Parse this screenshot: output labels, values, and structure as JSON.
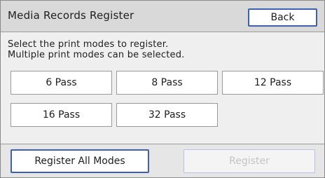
{
  "header": {
    "title": "Media Records Register",
    "back_label": "Back"
  },
  "instructions": {
    "line1": "Select the print modes to register.",
    "line2": "Multiple print modes can be selected."
  },
  "modes": [
    {
      "label": "6 Pass"
    },
    {
      "label": "8 Pass"
    },
    {
      "label": "12 Pass"
    },
    {
      "label": "16 Pass"
    },
    {
      "label": "32 Pass"
    }
  ],
  "footer": {
    "register_all_label": "Register All Modes",
    "register_label": "Register",
    "register_enabled": false
  },
  "colors": {
    "title_bar": "#d9d9d9",
    "accent_border": "#3f5fb0",
    "disabled_text": "#c4c4c4"
  }
}
